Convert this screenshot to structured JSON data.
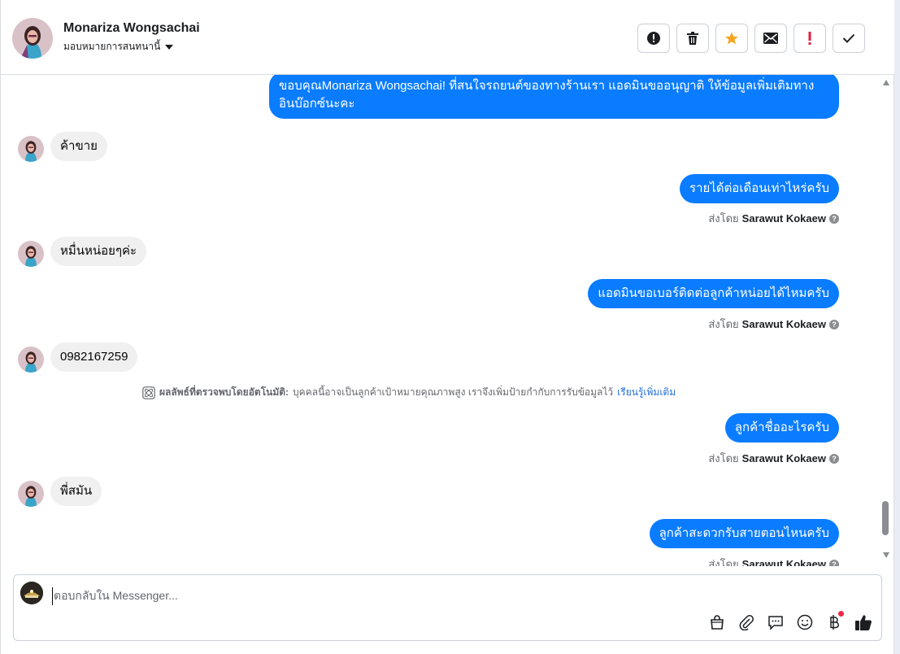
{
  "header": {
    "name": "Monariza Wongsachai",
    "assign_label": "มอบหมายการสนทนานี้",
    "actions": [
      {
        "icon": "exclamation-circle-icon"
      },
      {
        "icon": "trash-icon"
      },
      {
        "icon": "star-icon"
      },
      {
        "icon": "envelope-icon"
      },
      {
        "icon": "exclamation-icon"
      },
      {
        "icon": "check-icon"
      }
    ]
  },
  "messages": {
    "m1": "ขอบคุณMonariza Wongsachai! ที่สนใจรถยนต์ของทางร้านเรา แอดมินขออนุญาติ ให้ข้อมูลเพิ่มเติมทางอินบ๊อกซ์นะคะ",
    "m2": "ค้าขาย",
    "m3": "รายได้ต่อเดือนเท่าไหร่ครับ",
    "m4": "หมื่นหน่อยๆค่ะ",
    "m5": "แอดมินขอเบอร์ติดต่อลูกค้าหน่อยได้ไหมครับ",
    "m6": "0982167259",
    "m7": "ลูกค้าชื่ออะไรครับ",
    "m8": "พี่สมัน",
    "m9": "ลูกค้าสะดวกรับสายตอนไหนครับ"
  },
  "sent_by": {
    "prefix": "ส่งโดย",
    "agent": "Sarawut Kokaew"
  },
  "notice": {
    "title": "ผลลัพธ์ที่ตรวจพบโดยอัตโนมัติ:",
    "body": "บุคคลนี้อาจเป็นลูกค้าเป้าหมายคุณภาพสูง เราจึงเพิ่มป้ายกำกับการรับข้อมูลไว้",
    "link": "เรียนรู้เพิ่มเติม"
  },
  "composer": {
    "placeholder": "ตอบกลับใน Messenger..."
  },
  "colors": {
    "outgoing_bubble": "#0a7cff",
    "incoming_bubble": "#f0f0f0",
    "star": "#f5a623",
    "alert": "#e41e3f"
  }
}
